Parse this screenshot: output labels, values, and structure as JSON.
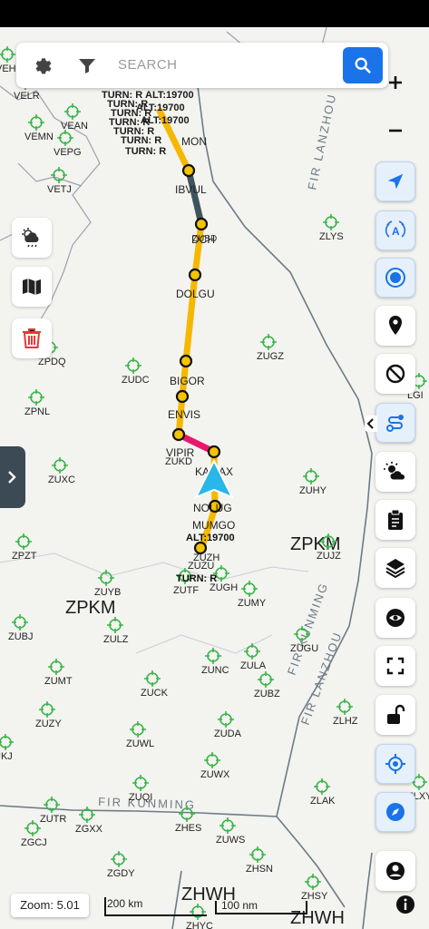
{
  "search": {
    "placeholder": "SEARCH"
  },
  "map": {
    "waypoints": [
      {
        "name": "DCH"
      },
      {
        "name": "ZUBD"
      },
      {
        "name": "DOLGU"
      },
      {
        "name": "IBVUL"
      },
      {
        "name": "BIGOR"
      },
      {
        "name": "ENVIS"
      },
      {
        "name": "VIPIR"
      },
      {
        "name": "ZUKD"
      },
      {
        "name": "KAMAX"
      },
      {
        "name": "NOLUG"
      },
      {
        "name": "MUMGO"
      },
      {
        "name": "MON"
      },
      {
        "name": "ZUZH"
      },
      {
        "name": "ZUZU"
      }
    ],
    "altitude_label": "ALT:19700",
    "turn_label": "TURN: R",
    "airports": [
      "VEHO",
      "VELR",
      "VEMN",
      "VEAN",
      "VEPG",
      "VETJ",
      "ZLYS",
      "ZUGZ",
      "ZUDC",
      "ZPDQ",
      "ZPNL",
      "ZUXC",
      "ZUHY",
      "ZPZT",
      "ZUJZ",
      "ZUYB",
      "ZUTF",
      "ZUGH",
      "ZUMY",
      "ZUBJ",
      "ZULZ",
      "ZUGU",
      "ZUNC",
      "ZULA",
      "ZUMT",
      "ZUCK",
      "ZUBZ",
      "ZUZY",
      "ZUDA",
      "ZLHZ",
      "UKJ",
      "ZUWL",
      "ZUWX",
      "ZUQI",
      "ZLAK",
      "ZUTR",
      "ZGXX",
      "ZHES",
      "ZUWS",
      "ZGCJ",
      "ZHSN",
      "ZGDY",
      "ZHSY",
      "ZHYC",
      "ZLXY",
      "LGI"
    ],
    "fir_labels": [
      "FIR LANZHOU",
      "FIR KUNMING",
      "FIR KUNMING",
      "FIR LANZHOU"
    ],
    "region_labels": [
      "ZPKM",
      "ZPKM",
      "ZHWH",
      "ZHWH"
    ]
  },
  "status": {
    "zoom": "Zoom: 5.01",
    "scale_km": "200 km",
    "scale_nm": "100 nm"
  },
  "colors": {
    "route": "#f5b800",
    "route_leg_active": "#e8176a",
    "aircraft": "#29b6e8",
    "airport": "#3bb54a",
    "accent": "#1a73e8"
  }
}
